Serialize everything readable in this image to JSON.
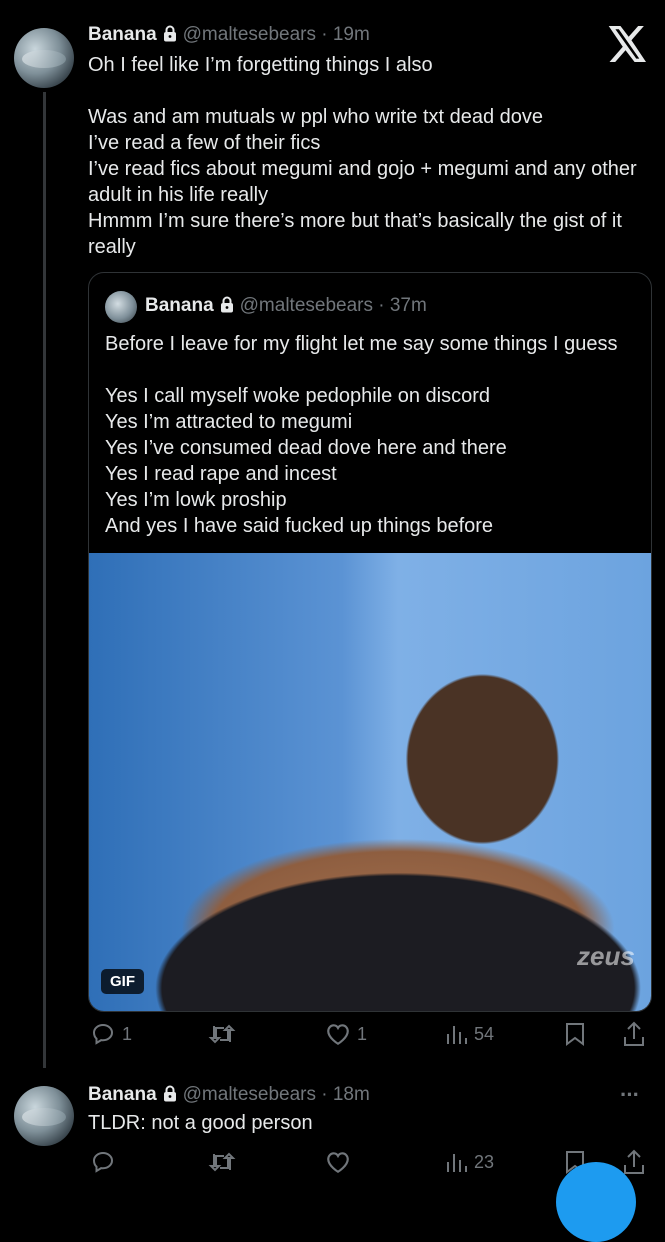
{
  "tweet1": {
    "name": "Banana",
    "handle": "@maltesebears · 19m",
    "text": "Oh I feel like I’m forgetting things I also\n\nWas and am mutuals w ppl who write txt dead dove\nI’ve read a few of their fics\nI’ve read fics about megumi and gojo + megumi and any other adult in his life really\nHmmm I’m sure there’s more but that’s basically the gist of it really",
    "stats": {
      "replies": "1",
      "retweets": "",
      "likes": "1",
      "views": "54"
    }
  },
  "quote": {
    "name": "Banana",
    "handle": "@maltesebears · 37m",
    "text": "Before I leave for my flight let me say some things I guess\n\nYes I call myself woke pedophile on discord\nYes I’m attracted to megumi\nYes I’ve consumed dead dove here and there\nYes I read rape and incest\nYes I’m lowk proship\nAnd yes I have said fucked up things before",
    "gif_label": "GIF",
    "watermark": "zeus"
  },
  "tweet2": {
    "name": "Banana",
    "handle": "@maltesebears · 18m",
    "text": "TLDR: not a good person",
    "stats": {
      "replies": "",
      "retweets": "",
      "likes": "",
      "views": "23"
    },
    "more": "···"
  },
  "icons": [
    "x-logo-icon",
    "lock-icon",
    "reply-icon",
    "retweet-icon",
    "like-icon",
    "views-icon",
    "bookmark-icon",
    "share-icon"
  ],
  "colors": {
    "background": "#000000",
    "text": "#e7e9ea",
    "muted": "#71767b",
    "accent": "#1d9bf0"
  }
}
